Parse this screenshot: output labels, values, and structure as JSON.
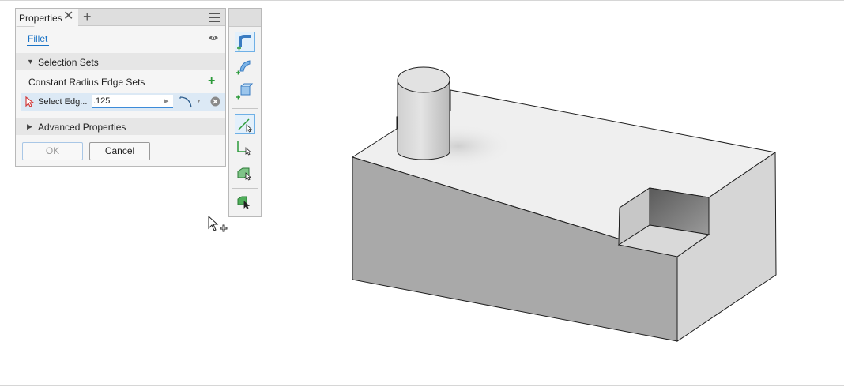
{
  "panel": {
    "tab_label": "Properties",
    "close_glyph": "✕",
    "add_tab_glyph": "+",
    "feature_name": "Fillet",
    "selection_sets_header": "Selection Sets",
    "edge_sets_label": "Constant Radius Edge Sets",
    "edge_sets_add_glyph": "+",
    "edge_row": {
      "select_label": "Select Edg...",
      "radius_value": ".125"
    },
    "advanced_header": "Advanced Properties",
    "ok_label": "OK",
    "cancel_label": "Cancel",
    "apply_glyph": "+"
  },
  "toolbar": {
    "buttons": [
      {
        "name": "constant-radius-fillet-icon",
        "active": true
      },
      {
        "name": "variable-radius-fillet-icon",
        "active": false
      },
      {
        "name": "setback-fillet-icon",
        "active": false
      },
      {
        "name": "edge-select-mode-icon",
        "active": true
      },
      {
        "name": "loop-select-mode-icon",
        "active": false
      },
      {
        "name": "feature-select-mode-icon",
        "active": false
      },
      {
        "name": "all-fillets-icon",
        "active": false
      }
    ]
  },
  "colors": {
    "accent": "#1a73c6",
    "add_green": "#2b9a3a",
    "selected_row": "#dce9f5"
  }
}
